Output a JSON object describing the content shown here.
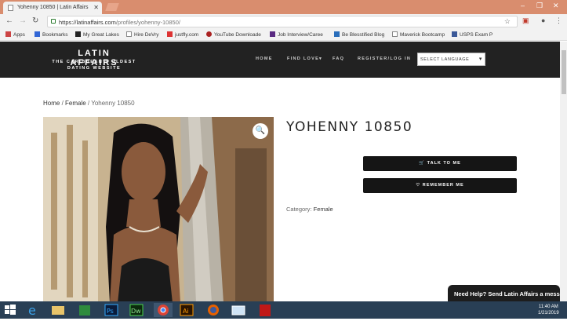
{
  "browser": {
    "tab_title": "Yohenny 10850 | Latin Affairs",
    "url_host": "https://latinaffairs.com",
    "url_path": "/profiles/yohenny-10850/"
  },
  "bookmarks": [
    {
      "label": "Apps"
    },
    {
      "label": "Bookmarks"
    },
    {
      "label": "My Great Lakes"
    },
    {
      "label": "Hire DeVry"
    },
    {
      "label": "justfly.com"
    },
    {
      "label": "YouTube Downloade"
    },
    {
      "label": "Job Interview/Caree"
    },
    {
      "label": "Be Blesstified Blog"
    },
    {
      "label": "Maverick Bootcamp"
    },
    {
      "label": "USPS Exam P"
    }
  ],
  "site": {
    "logo_title": "LATIN AFFAIRS",
    "logo_tagline": "THE CARIBBEAN'S OLDEST DATING WEBSITE",
    "menu": {
      "home": "HOME",
      "find_love": "FIND LOVE",
      "faq": "FAQ",
      "register": "REGISTER/LOG IN"
    },
    "language_select": "SELECT LANGUAGE"
  },
  "breadcrumb": {
    "home": "Home",
    "sep1": " / ",
    "category": "Female",
    "sep2": " / ",
    "current": "Yohenny 10850"
  },
  "product": {
    "title": "YOHENNY 10850",
    "talk_button": "TALK TO ME",
    "remember_button": "REMEMBER ME",
    "category_label": "Category:",
    "category_value": "Female"
  },
  "chat": {
    "label": "Need Help? Send Latin Affairs a messa"
  },
  "taskbar": {
    "time": "11:40 AM",
    "date": "1/21/2019"
  },
  "colors": {
    "header_bg": "#222222",
    "button_bg": "#151515",
    "chrome_frame": "#d98d6e",
    "taskbar_bg": "#293f55"
  }
}
